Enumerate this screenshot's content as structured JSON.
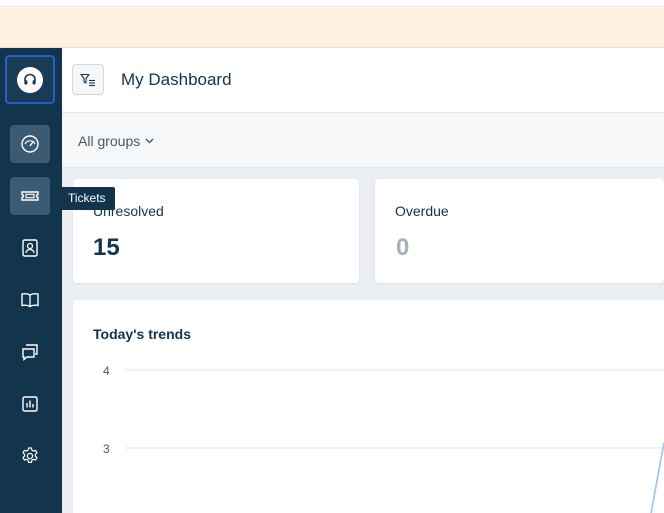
{
  "header": {
    "title": "My Dashboard"
  },
  "tooltip": "Tickets",
  "filters": {
    "group": "All groups"
  },
  "cards": [
    {
      "label": "Unresolved",
      "value": "15"
    },
    {
      "label": "Overdue",
      "value": "0"
    }
  ],
  "chart_data": {
    "type": "line",
    "title": "Today's trends",
    "y_ticks": [
      "4",
      "3"
    ],
    "ylim": [
      3,
      4
    ],
    "series": [
      {
        "values": []
      }
    ]
  },
  "icons": {
    "logo": "headset-icon",
    "nav": [
      "dashboard-icon",
      "ticket-icon",
      "contacts-icon",
      "book-icon",
      "conversations-icon",
      "reports-icon",
      "gear-icon"
    ],
    "filter": "filter-icon",
    "dropdown": "chevron-down-icon"
  },
  "colors": {
    "sidebar": "#12344d",
    "banner": "#fef1e1",
    "accent": "#2c5cc5",
    "trend_line": "#9ec0f0"
  }
}
